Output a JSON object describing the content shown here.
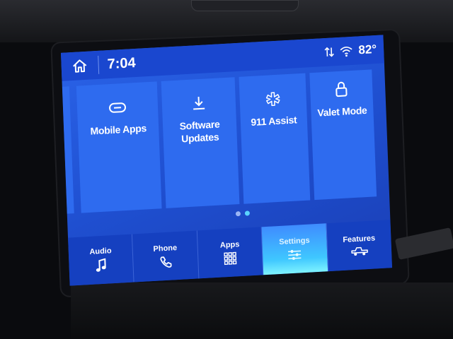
{
  "status": {
    "time": "7:04",
    "temperature": "82°"
  },
  "tiles": [
    {
      "label": "Mobile Apps",
      "icon": "link-icon"
    },
    {
      "label": "Software Updates",
      "icon": "download-icon"
    },
    {
      "label": "911 Assist",
      "icon": "emergency-asterisk-icon"
    },
    {
      "label": "Valet Mode",
      "icon": "lock-icon"
    }
  ],
  "nav": {
    "audio": "Audio",
    "phone": "Phone",
    "apps": "Apps",
    "settings": "Settings",
    "features": "Features"
  },
  "pager": {
    "pages": 2,
    "active_page": 2
  },
  "colors": {
    "screen_blue": "#2a63e8",
    "active_tab": "#3fc7ff"
  }
}
